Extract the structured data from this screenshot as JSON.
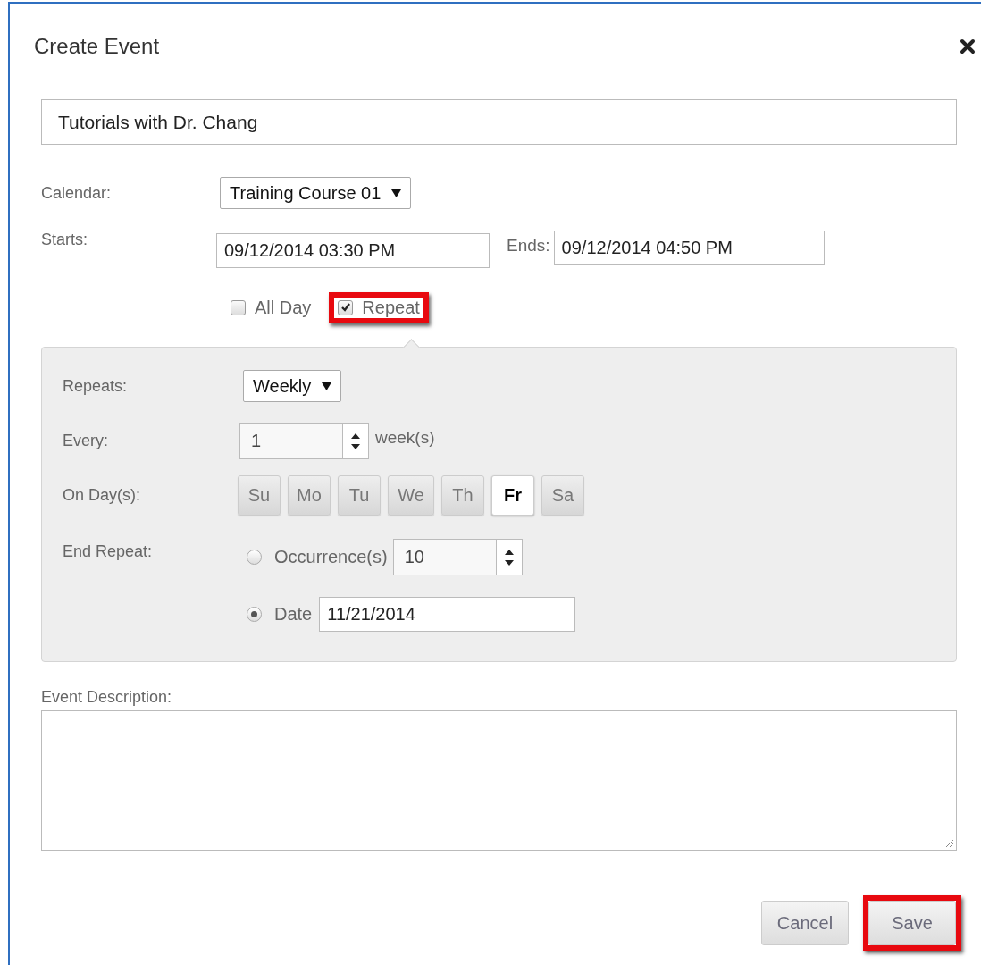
{
  "dialog": {
    "title": "Create Event"
  },
  "event_title": {
    "value": "Tutorials with Dr. Chang"
  },
  "calendar": {
    "label": "Calendar:",
    "value": "Training Course 01"
  },
  "starts": {
    "label": "Starts:",
    "value": "09/12/2014 03:30 PM"
  },
  "ends": {
    "label": "Ends:",
    "value": "09/12/2014 04:50 PM"
  },
  "options": [
    {
      "label": "All Day",
      "checked": false,
      "highlighted": false
    },
    {
      "label": "Repeat",
      "checked": true,
      "highlighted": true
    }
  ],
  "repeat": {
    "repeats": {
      "label": "Repeats:",
      "value": "Weekly"
    },
    "every": {
      "label": "Every:",
      "value": "1",
      "unit": "week(s)"
    },
    "days": {
      "label": "On Day(s):",
      "items": [
        {
          "label": "Su",
          "selected": false
        },
        {
          "label": "Mo",
          "selected": false
        },
        {
          "label": "Tu",
          "selected": false
        },
        {
          "label": "We",
          "selected": false
        },
        {
          "label": "Th",
          "selected": false
        },
        {
          "label": "Fr",
          "selected": true
        },
        {
          "label": "Sa",
          "selected": false
        }
      ]
    },
    "end_repeat": {
      "label": "End Repeat:",
      "options": [
        {
          "kind": "occurrences",
          "label": "Occurrence(s)",
          "value": "10",
          "selected": false
        },
        {
          "kind": "date",
          "label": "Date",
          "value": "11/21/2014",
          "selected": true
        }
      ]
    }
  },
  "description": {
    "label": "Event Description:"
  },
  "buttons": [
    {
      "label": "Cancel",
      "highlighted": false
    },
    {
      "label": "Save",
      "highlighted": true
    }
  ]
}
